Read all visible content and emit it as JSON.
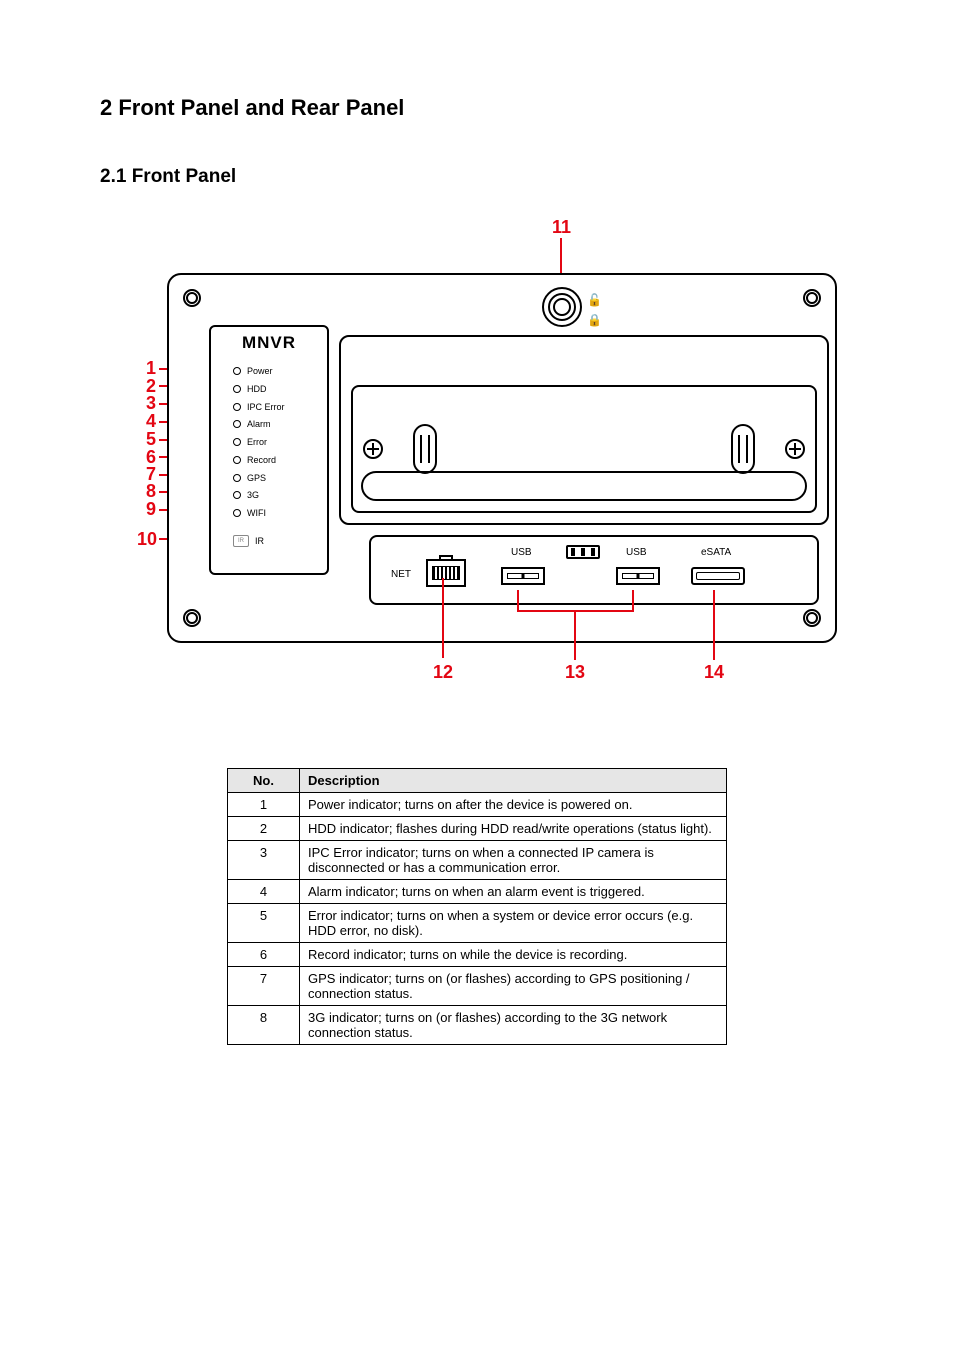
{
  "headings": {
    "section": "2  Front Panel and Rear Panel",
    "subsection": "2.1  Front Panel"
  },
  "device_label": "MNVR",
  "leds": [
    {
      "n": "1",
      "label": "Power"
    },
    {
      "n": "2",
      "label": "HDD"
    },
    {
      "n": "3",
      "label": "IPC Error"
    },
    {
      "n": "4",
      "label": "Alarm"
    },
    {
      "n": "5",
      "label": "Error"
    },
    {
      "n": "6",
      "label": "Record"
    },
    {
      "n": "7",
      "label": "GPS"
    },
    {
      "n": "8",
      "label": "3G"
    },
    {
      "n": "9",
      "label": "WIFI"
    }
  ],
  "ir": {
    "n": "10",
    "label": "IR",
    "box": "IR"
  },
  "callouts": {
    "top": "11",
    "net": "12",
    "usb": "13",
    "esata": "14"
  },
  "ports": {
    "net": "NET",
    "usb": "USB",
    "esata": "eSATA"
  },
  "table": {
    "headers": [
      "No.",
      "Description"
    ],
    "rows": [
      {
        "no": "1",
        "desc": "Power indicator; turns on after the device is powered on."
      },
      {
        "no": "2",
        "desc": "HDD indicator; flashes during HDD read/write operations (status light)."
      },
      {
        "no": "3",
        "desc": "IPC Error indicator; turns on when a connected IP camera is disconnected or has a communication error."
      },
      {
        "no": "4",
        "desc": "Alarm indicator; turns on when an alarm event is triggered."
      },
      {
        "no": "5",
        "desc": "Error indicator; turns on when a system or device error occurs (e.g. HDD error, no disk)."
      },
      {
        "no": "6",
        "desc": "Record indicator; turns on while the device is recording."
      },
      {
        "no": "7",
        "desc": "GPS indicator; turns on (or flashes) according to GPS positioning / connection status."
      },
      {
        "no": "8",
        "desc": "3G indicator; turns on (or flashes) according to the 3G network connection status."
      }
    ]
  }
}
